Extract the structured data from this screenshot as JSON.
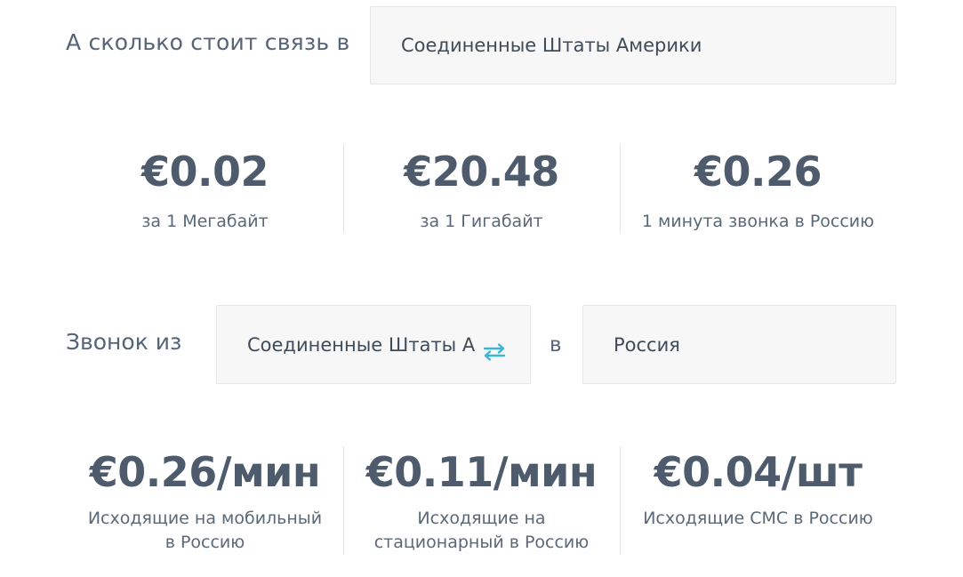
{
  "query": {
    "label": "А сколько стоит связь в",
    "country": "Соединенные Штаты Америки"
  },
  "data_rates": [
    {
      "value": "€0.02",
      "desc": "за 1 Мегабайт"
    },
    {
      "value": "€20.48",
      "desc": "за 1 Гигабайт"
    },
    {
      "value": "€0.26",
      "desc": "1 минута звонка в Россию"
    }
  ],
  "call": {
    "label": "Звонок из",
    "from": "Соединенные Штаты Америки",
    "in_label": "в",
    "to": "Россия",
    "swap_icon": "swap-arrows-icon",
    "accent_color": "#3bb4d8"
  },
  "call_rates": [
    {
      "value": "€0.26/мин",
      "desc": "Исходящие на мобильный в Россию"
    },
    {
      "value": "€0.11/мин",
      "desc": "Исходящие на стационарный в Россию"
    },
    {
      "value": "€0.04/шт",
      "desc": "Исходящие СМС в Россию"
    }
  ]
}
